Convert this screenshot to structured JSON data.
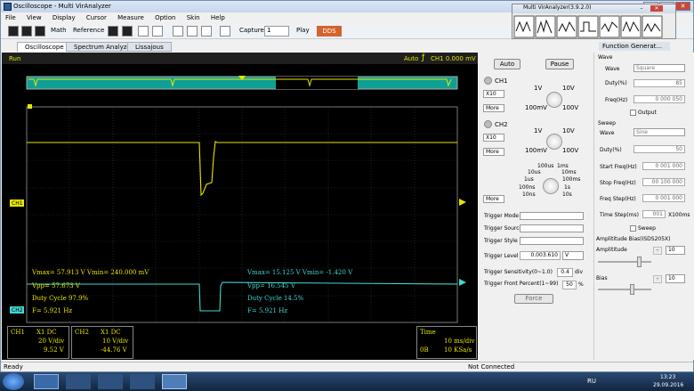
{
  "window": {
    "title": "Oscilloscope - Multi VirAnalyzer"
  },
  "menu": [
    "File",
    "View",
    "Display",
    "Cursor",
    "Measure",
    "Option",
    "Skin",
    "Help"
  ],
  "toolbar": {
    "math": "Math",
    "reference": "Reference",
    "capture_label": "Capture",
    "capture_value": "1",
    "play": "Play",
    "dds": "DDS"
  },
  "tabs": [
    "Oscilloscope",
    "Spectrum Analyzer",
    "Lissajous"
  ],
  "scope": {
    "run_label": "Run",
    "trigger_info": "Auto",
    "channel_info": "CH1  0.000 mV",
    "ch1_marker": "CH1",
    "ch2_marker": "CH2",
    "ch1_meas": {
      "vmax": "Vmax= 57.913 V  Vmin= 240.000 mV",
      "vpp": "Vpp= 57.673 V",
      "duty": "Duty Cycle 97.9%",
      "freq": "F= 5.921 Hz"
    },
    "ch2_meas": {
      "vmax": "Vmax= 15.125 V  Vmin= -1.420 V",
      "vpp": "Vpp= 16.545 V",
      "duty": "Duty Cycle 14.5%",
      "freq": "F= 5.921 Hz"
    }
  },
  "bottom": {
    "ch1": {
      "name": "CH1",
      "coupling": "X1  DC",
      "scale": "20 V/div",
      "value": "9.52 V"
    },
    "ch2": {
      "name": "CH2",
      "coupling": "X1  DC",
      "scale": "10 V/div",
      "value": "-44.76 V"
    },
    "time": {
      "label": "Time",
      "div": "10 ms/div",
      "rate_left": "0B",
      "rate": "10 KSa/s"
    }
  },
  "controls": {
    "auto": "Auto",
    "pause": "Pause",
    "ch1": "CH1",
    "ch2": "CH2",
    "x10_1": "X10",
    "x10_2": "X10",
    "more": "More",
    "volt_knob": {
      "l1": "1V",
      "l2": "10V",
      "l3": "100mV",
      "l4": "100V"
    },
    "time_knob": {
      "t1": "100us",
      "t2": "1ms",
      "t3": "10us",
      "t4": "10ms",
      "t5": "1us",
      "t6": "100ms",
      "t7": "100ns",
      "t8": "1s",
      "t9": "10ns",
      "t10": "10s"
    },
    "trigger_mode": "Trigger Mode",
    "trigger_source": "Trigger Source",
    "trigger_style": "Trigger Style",
    "trigger_level": "Trigger Level",
    "trigger_level_value": "0.003.610",
    "trigger_unit": "V",
    "trigger_sens": "Trigger Sensitivity(0~1.0)",
    "trigger_sens_value": "0.4",
    "trigger_sens_unit": "div",
    "trigger_front": "Trigger Front Percent(1~99)",
    "trigger_front_value": "50",
    "trigger_front_unit": "%",
    "force": "Force"
  },
  "fg": {
    "panel_title": "Function Generat...",
    "wave_header": "Wave",
    "wave_label": "Wave",
    "wave_value": "Square",
    "duty_label": "Duty(%)",
    "duty_value": "85",
    "freq_label": "Freq(Hz)",
    "freq_value": "0 000 050",
    "output": "Output",
    "sweep_header": "Sweep",
    "sw_wave_label": "Wave",
    "sw_wave_value": "Sine",
    "sw_duty_label": "Duty(%)",
    "sw_duty_value": "50",
    "start_label": "Start Freq(Hz)",
    "start_value": "0 001 000",
    "stop_label": "Stop Freq(Hz)",
    "stop_value": "00 100 000",
    "step_label": "Freq Step(Hz)",
    "step_value": "0 001 000",
    "time_label": "Time Step(ms)",
    "time_value": "001",
    "time_unit": "X100ms",
    "sweep_check": "Sweep",
    "amp_header": "Amplititude Bias(ISDS205X)",
    "amp_label": "Amplititude",
    "amp_value": "10",
    "bias_label": "Bias",
    "bias_value": "10"
  },
  "multi": {
    "title": "Multi VirAnalyzer(3.9.2.0)"
  },
  "status": {
    "left": "Ready",
    "mid": "Not Connected"
  },
  "taskbar": {
    "lang": "RU",
    "time": "13:23",
    "date": "29.09.2016"
  }
}
